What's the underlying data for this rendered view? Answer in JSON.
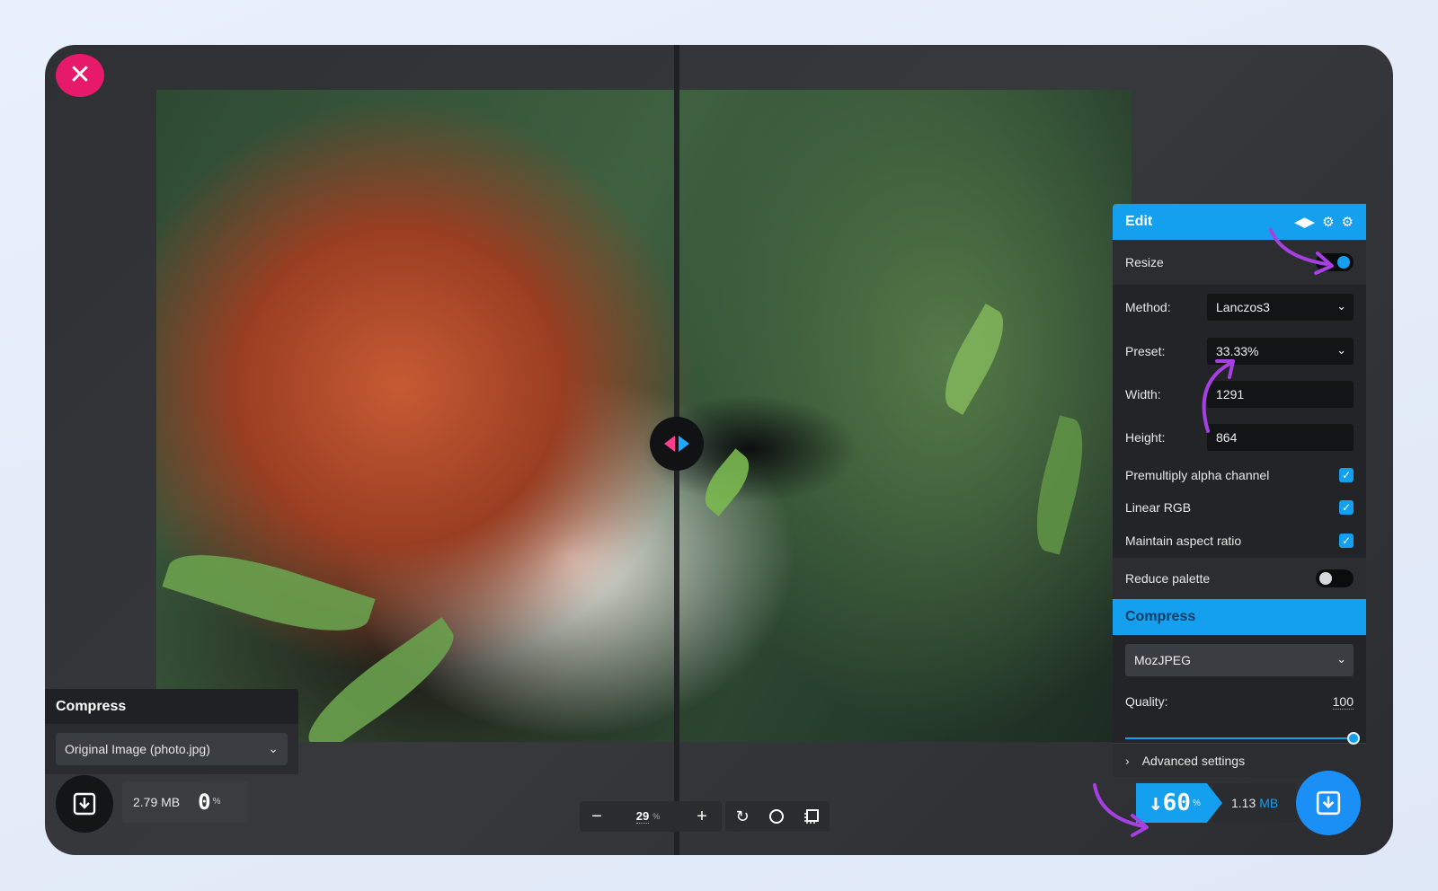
{
  "close_label": "✕",
  "left": {
    "header": "Compress",
    "source_select": "Original Image (photo.jpg)",
    "size_value": "2.79 MB",
    "percent_value": "0",
    "percent_unit": "%"
  },
  "zoom": {
    "minus": "−",
    "value": "29",
    "unit": "%",
    "plus": "+"
  },
  "edit": {
    "header": "Edit",
    "resize_label": "Resize",
    "resize_on": true,
    "method_label": "Method:",
    "method_value": "Lanczos3",
    "preset_label": "Preset:",
    "preset_value": "33.33%",
    "width_label": "Width:",
    "width_value": "1291",
    "height_label": "Height:",
    "height_value": "864",
    "premultiply_label": "Premultiply alpha channel",
    "linear_rgb_label": "Linear RGB",
    "aspect_label": "Maintain aspect ratio",
    "reduce_palette_label": "Reduce palette",
    "reduce_palette_on": false
  },
  "compress": {
    "header": "Compress",
    "codec_value": "MozJPEG",
    "quality_label": "Quality:",
    "quality_value": "100",
    "quality_fraction": 1.0,
    "advanced_label": "Advanced settings"
  },
  "result": {
    "saved_arrow": "↓",
    "saved_value": "60",
    "saved_unit": "%",
    "size_value": "1.13",
    "size_unit": "MB"
  },
  "colors": {
    "accent": "#14a0ee",
    "close": "#e6196b",
    "annotation": "#a640e0"
  }
}
